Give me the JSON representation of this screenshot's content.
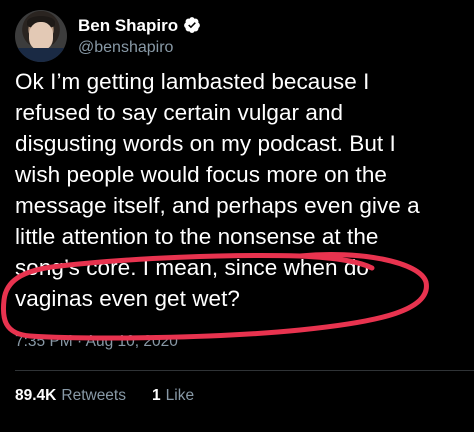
{
  "tweet": {
    "author": {
      "display_name": "Ben Shapiro",
      "handle": "@benshapiro",
      "verified": true
    },
    "text_lines": [
      "Ok I’m getting lambasted because I",
      "refused to say certain vulgar and",
      "disgusting words on my podcast. But I",
      "wish people would focus more on the",
      "message itself, and perhaps even give a",
      "little attention to the nonsense at the",
      "song’s core. I mean, since when do",
      "vaginas even get wet?"
    ],
    "timestamp": "7:35 PM · Aug 10, 2020",
    "stats": {
      "retweets_count": "89.4K",
      "retweets_label": "Retweets",
      "likes_count": "1",
      "likes_label": "Like"
    }
  },
  "colors": {
    "background": "#000000",
    "primary_text": "#ffffff",
    "secondary_text": "#8899a6",
    "verified_badge": "#ffffff",
    "annotation_stroke": "#e8334f"
  },
  "icons": {
    "verified": "verified-badge-icon"
  }
}
